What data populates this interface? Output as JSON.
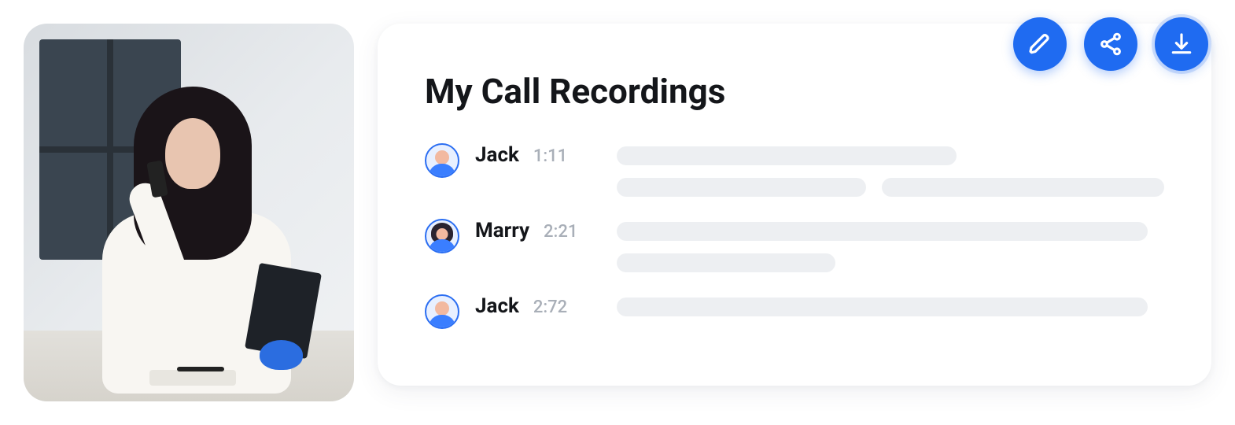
{
  "photo": {
    "alt": "Woman on phone holding notebook at desk"
  },
  "card": {
    "title": "My Call Recordings"
  },
  "recordings": [
    {
      "name": "Jack",
      "time": "1:11",
      "avatar": "male"
    },
    {
      "name": "Marry",
      "time": "2:21",
      "avatar": "female"
    },
    {
      "name": "Jack",
      "time": "2:72",
      "avatar": "male"
    }
  ],
  "actions": {
    "edit": {
      "icon": "pencil-icon",
      "label": "Edit"
    },
    "share": {
      "icon": "share-icon",
      "label": "Share"
    },
    "download": {
      "icon": "download-icon",
      "label": "Download"
    }
  },
  "colors": {
    "accent": "#1f6bf1",
    "placeholder": "#edeff2",
    "textMuted": "#a9afb8"
  }
}
